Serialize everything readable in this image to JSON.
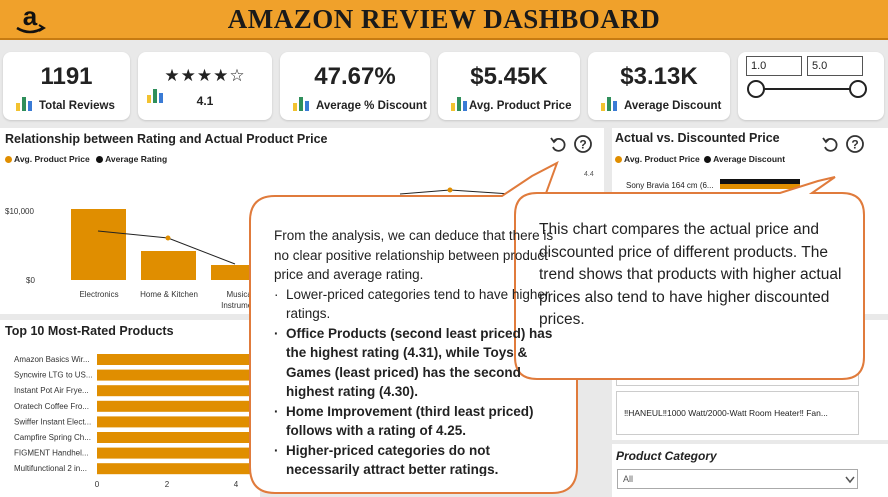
{
  "header": {
    "title": "AMAZON REVIEW DASHBOARD",
    "logo_icon": "amazon-logo-icon"
  },
  "kpis": {
    "total_reviews": {
      "value": "1191",
      "label": "Total Reviews"
    },
    "rating": {
      "stars": "★★★★☆",
      "value": "4.1"
    },
    "avg_discount_pct": {
      "value": "47.67%",
      "label": "Average % Discount"
    },
    "avg_product_price": {
      "value": "$5.45K",
      "label": "Avg. Product Price"
    },
    "avg_discount": {
      "value": "$3.13K",
      "label": "Average Discount"
    }
  },
  "rating_slider": {
    "min": "1.0",
    "max": "5.0"
  },
  "chart1": {
    "title": "Relationship between Rating and Actual Product Price",
    "legend": [
      "Avg. Product Price",
      "Average Rating"
    ],
    "y_ticks": [
      "$10,000",
      "$0"
    ],
    "categories": [
      "Electronics",
      "Home & Kitchen",
      "Musical Instruments"
    ],
    "category_lines": [
      [
        "Electronics"
      ],
      [
        "Home & Kitchen"
      ],
      [
        "Musical",
        "Instrume..."
      ]
    ]
  },
  "chart2": {
    "title": "Actual vs. Discounted Price",
    "legend": [
      "Avg. Product Price",
      "Average Discount"
    ],
    "axis_label": "4.4",
    "item": "Sony Bravia 164 cm (6..."
  },
  "chart3": {
    "title": "Top 10 Most-Rated Products",
    "products": [
      "Amazon Basics Wir...",
      "Syncwire LTG to US...",
      "Instant Pot Air Frye...",
      "Oratech Coffee Fro...",
      "Swiffer Instant Elect...",
      "Campfire Spring Ch...",
      "FIGMENT Handhel...",
      "Multifunctional 2 in..."
    ],
    "x_ticks": [
      "0",
      "2",
      "4"
    ]
  },
  "callout_left": {
    "intro": "From the analysis, we can deduce that there is no clear positive relationship between product price and average rating.",
    "bullets": [
      {
        "text": "Lower-priced categories tend to have higher ratings.",
        "bold": false
      },
      {
        "text": "Office Products (second least priced) has the highest rating (4.31), while Toys & Games (least priced) has the second highest rating (4.30).",
        "bold": true
      },
      {
        "text": "Home Improvement (third least priced) follows with a rating of 4.25.",
        "bold": true
      },
      {
        "text": "Higher-priced categories do not necessarily attract better ratings.",
        "bold": true
      }
    ],
    "bullet_char": "·"
  },
  "callout_right": {
    "text": "This chart compares the actual price and discounted price of different products. The trend shows that products with higher actual prices also tend to have higher discounted prices."
  },
  "product_list": {
    "item": "‼HANEUL‼1000 Watt/2000-Watt Room Heater‼ Fan..."
  },
  "category_filter": {
    "title": "Product Category",
    "value": "All"
  },
  "colors": {
    "header": "#f0a12b",
    "bar": "#e08e00",
    "dark": "#1a1a1a",
    "callout_border": "#e07b3c"
  }
}
